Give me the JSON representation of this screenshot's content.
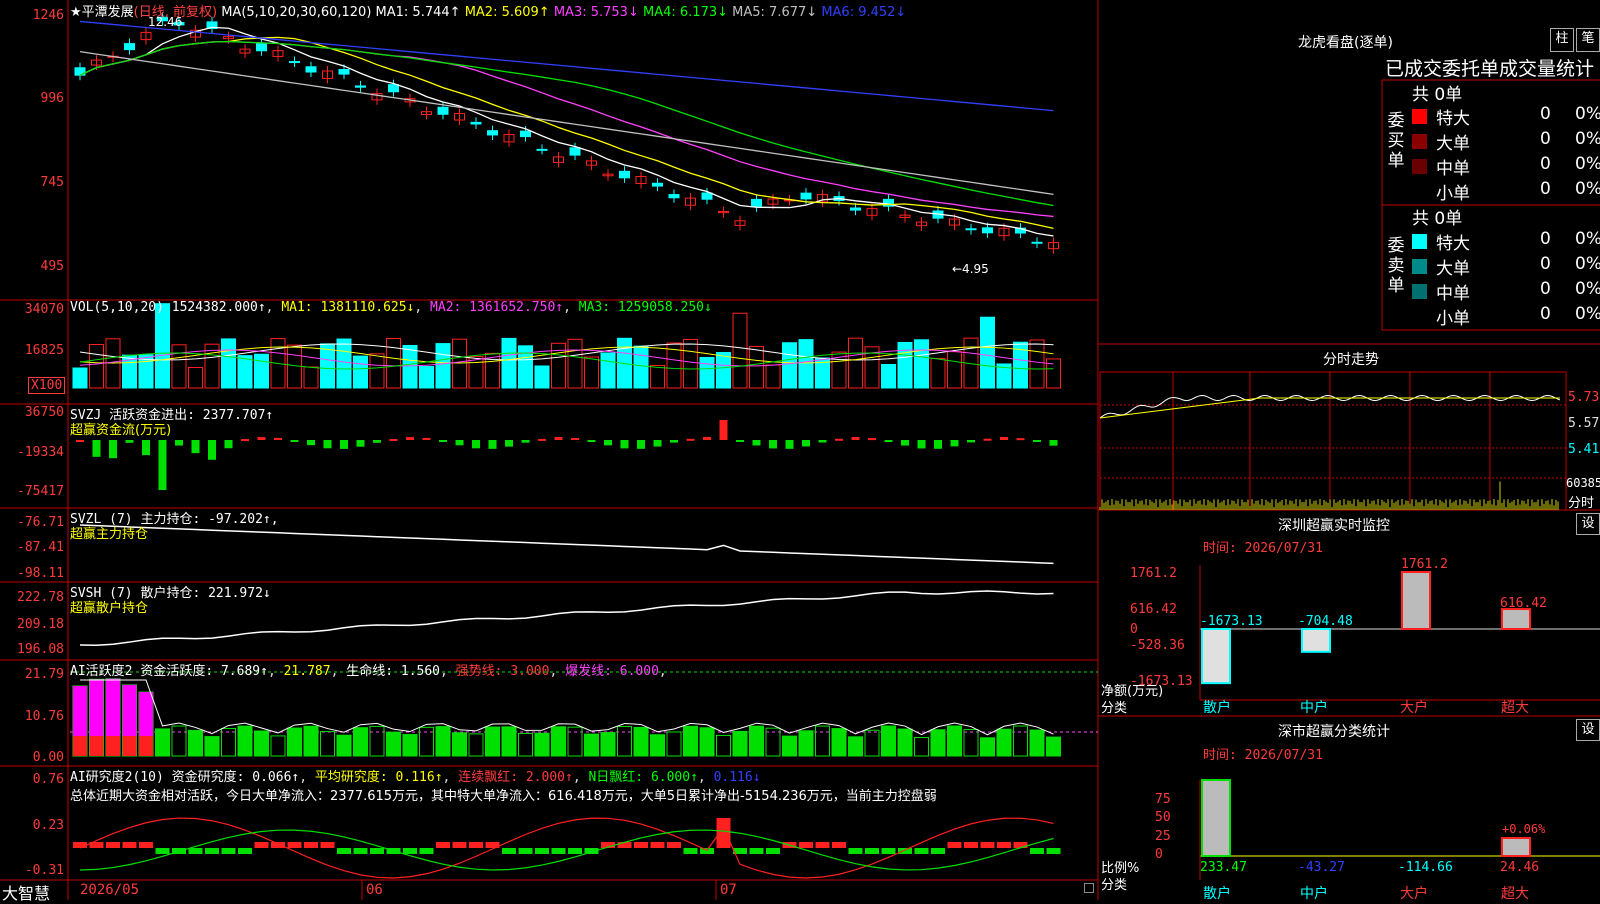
{
  "main_chart": {
    "title": "★平潭发展",
    "mode": "(日线, 前复权)",
    "ma_header": "MA(5,10,20,30,60,120)",
    "ma1": "MA1: 5.744↑",
    "ma2": "MA2: 5.609↑",
    "ma3": "MA3: 5.753↓",
    "ma4": "MA4: 6.173↓",
    "ma5": "MA5: 7.677↓",
    "ma6": "MA6: 9.452↓",
    "high_label": "12.46",
    "low_label": "←4.95",
    "y_ticks": [
      "1246",
      "996",
      "745",
      "495"
    ]
  },
  "vol_panel": {
    "header": "VOL(5,10,20)",
    "value": "1524382.000↑",
    "ma1": "MA1: 1381110.625↓",
    "ma2": "MA2: 1361652.750↑",
    "ma3": "MA3: 1259058.250↓",
    "y_ticks": [
      "34070",
      "16825"
    ],
    "unit": "X100"
  },
  "svzj_panel": {
    "header": "SVZJ",
    "value": "活跃资金进出: 2377.707↑",
    "subtitle": "超赢资金流(万元)",
    "y_ticks": [
      "36750",
      "-19334",
      "-75417"
    ]
  },
  "svzl_panel": {
    "header": "SVZL (7)",
    "value": "主力持仓: -97.202↑",
    "subtitle": "超赢主力持仓",
    "y_ticks": [
      "-76.71",
      "-87.41",
      "-98.11"
    ]
  },
  "svsh_panel": {
    "header": "SVSH (7)",
    "value": "散户持仓: 221.972↓",
    "subtitle": "超赢散户持仓",
    "y_ticks": [
      "222.78",
      "209.18",
      "196.08"
    ]
  },
  "ai_active_panel": {
    "header": "AI活跃度2",
    "value": "资金活跃度: 7.689↑",
    "v2": "21.787",
    "life": "生命线: 1.560",
    "strong": "强势线: 3.000",
    "burst": "爆发线: 6.000",
    "y_ticks": [
      "21.79",
      "10.76",
      "0.00"
    ]
  },
  "ai_research_panel": {
    "header": "AI研究度2(10)",
    "research": "资金研究度: 0.066↑",
    "avg": "平均研究度: 0.116↑",
    "red": "连续飘红: 2.000↑",
    "nday": "N日飘红: 6.000↑",
    "last": "0.116↓",
    "summary": "总体近期大资金相对活跃，今日大单净流入：2377.615万元，其中特大单净流入：616.418万元，大单5日累计净出-5154.236万元，当前主力控盘弱",
    "y_ticks": [
      "0.76",
      "0.23",
      "-0.31"
    ]
  },
  "bottom_bar": {
    "brand": "大智慧",
    "dates": [
      "2026/05",
      "06",
      "07"
    ]
  },
  "dragon_panel": {
    "title": "龙虎看盘(逐单)",
    "btn1": "柱",
    "btn2": "笔",
    "subtitle": "已成交委托单成交量统计",
    "buy_label": [
      "委",
      "买",
      "单"
    ],
    "sell_label": [
      "委",
      "卖",
      "单"
    ],
    "buy_total": "共 0单",
    "sell_total": "共 0单",
    "buy_rows": [
      {
        "name": "特大",
        "count": "0",
        "pct": "0%",
        "color": "#ff0000"
      },
      {
        "name": "大单",
        "count": "0",
        "pct": "0%",
        "color": "#8b0000"
      },
      {
        "name": "中单",
        "count": "0",
        "pct": "0%",
        "color": "#6b0000"
      },
      {
        "name": "小单",
        "count": "0",
        "pct": "0%",
        "color": "#000000"
      }
    ],
    "sell_rows": [
      {
        "name": "特大",
        "count": "0",
        "pct": "0%",
        "color": "#00ffff"
      },
      {
        "name": "大单",
        "count": "0",
        "pct": "0%",
        "color": "#008b8b"
      },
      {
        "name": "中单",
        "count": "0",
        "pct": "0%",
        "color": "#007070"
      },
      {
        "name": "小单",
        "count": "0",
        "pct": "0%",
        "color": "#000000"
      }
    ]
  },
  "intraday_panel": {
    "title": "分时走势",
    "y_ticks": [
      "5.73",
      "5.57",
      "5.41"
    ],
    "vol_label": "60385",
    "unit": "分时"
  },
  "monitor_panel": {
    "title": "深圳超赢实时监控",
    "btn": "设",
    "time": "时间: 2026/07/31",
    "y_ticks": [
      "1761.2",
      "616.42",
      "0",
      "-528.36",
      "-1673.13"
    ],
    "ylabel": "净额(万元)",
    "xlabel": "分类",
    "categories": [
      "散户",
      "中户",
      "大户",
      "超大"
    ],
    "values": [
      "-1673.13",
      "-704.48",
      "1761.2",
      "616.42"
    ]
  },
  "stats_panel": {
    "title": "深市超赢分类统计",
    "btn": "设",
    "time": "时间: 2026/07/31",
    "y_ticks": [
      "75",
      "50",
      "25",
      "0"
    ],
    "ylabel": "比例%",
    "xlabel": "分类",
    "categories": [
      "散户",
      "中户",
      "大户",
      "超大"
    ],
    "values": [
      "233.47",
      "-43.27",
      "-114.66",
      "24.46"
    ],
    "pct_label": "+0.06%"
  }
}
